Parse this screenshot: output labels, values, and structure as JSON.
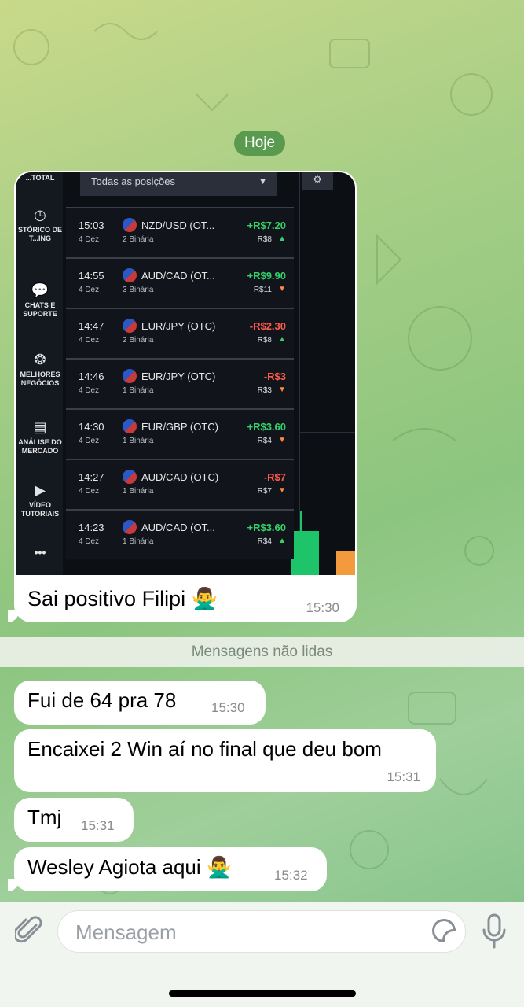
{
  "date_separator": "Hoje",
  "photo_message": {
    "caption": "Sai positivo Filipi 🙅‍♂️",
    "time": "15:30",
    "screenshot": {
      "header_left": "...TOTAL",
      "filter_label": "Todas as posições",
      "sidebar": [
        {
          "icon": "clock-icon",
          "label": "STÓRICO DE T...ING"
        },
        {
          "icon": "chat-icon",
          "label": "CHATS E SUPORTE"
        },
        {
          "icon": "medal-icon",
          "label": "MELHORES NEGÓCIOS"
        },
        {
          "icon": "newspaper-icon",
          "label": "ANÁLISE DO MERCADO"
        },
        {
          "icon": "play-icon",
          "label": "VÍDEO TUTORIAIS"
        },
        {
          "icon": "more-icon",
          "label": "•••"
        }
      ],
      "positions": [
        {
          "time": "15:03",
          "date": "4 Dez",
          "pair": "NZD/USD (OT...",
          "type": "2 Binária",
          "pnl": "+R$7.20",
          "amount": "R$8",
          "direction": "up"
        },
        {
          "time": "14:55",
          "date": "4 Dez",
          "pair": "AUD/CAD (OT...",
          "type": "3 Binária",
          "pnl": "+R$9.90",
          "amount": "R$11",
          "direction": "down"
        },
        {
          "time": "14:47",
          "date": "4 Dez",
          "pair": "EUR/JPY (OTC)",
          "type": "2 Binária",
          "pnl": "-R$2.30",
          "amount": "R$8",
          "direction": "up"
        },
        {
          "time": "14:46",
          "date": "4 Dez",
          "pair": "EUR/JPY (OTC)",
          "type": "1 Binária",
          "pnl": "-R$3",
          "amount": "R$3",
          "direction": "down"
        },
        {
          "time": "14:30",
          "date": "4 Dez",
          "pair": "EUR/GBP (OTC)",
          "type": "1 Binária",
          "pnl": "+R$3.60",
          "amount": "R$4",
          "direction": "down"
        },
        {
          "time": "14:27",
          "date": "4 Dez",
          "pair": "AUD/CAD (OTC)",
          "type": "1 Binária",
          "pnl": "-R$7",
          "amount": "R$7",
          "direction": "down"
        },
        {
          "time": "14:23",
          "date": "4 Dez",
          "pair": "AUD/CAD (OT...",
          "type": "1 Binária",
          "pnl": "+R$3.60",
          "amount": "R$4",
          "direction": "up"
        }
      ]
    }
  },
  "unread_label": "Mensagens não lidas",
  "messages": [
    {
      "text": "Fui de 64 pra 78",
      "time": "15:30"
    },
    {
      "text": "Encaixei 2 Win aí no final que deu bom",
      "time": "15:31"
    },
    {
      "text": "Tmj",
      "time": "15:31"
    },
    {
      "text": "Wesley Agiota aqui 🙅‍♂️",
      "time": "15:32"
    }
  ],
  "input": {
    "placeholder": "Mensagem"
  }
}
